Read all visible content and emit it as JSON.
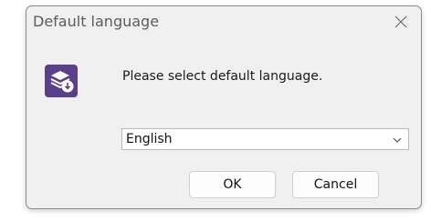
{
  "dialog": {
    "title": "Default language",
    "message": "Please select default language.",
    "icon": "app-install-icon",
    "accent_color": "#5a3f8a"
  },
  "language_select": {
    "value": "English"
  },
  "buttons": {
    "ok_label": "OK",
    "cancel_label": "Cancel"
  }
}
